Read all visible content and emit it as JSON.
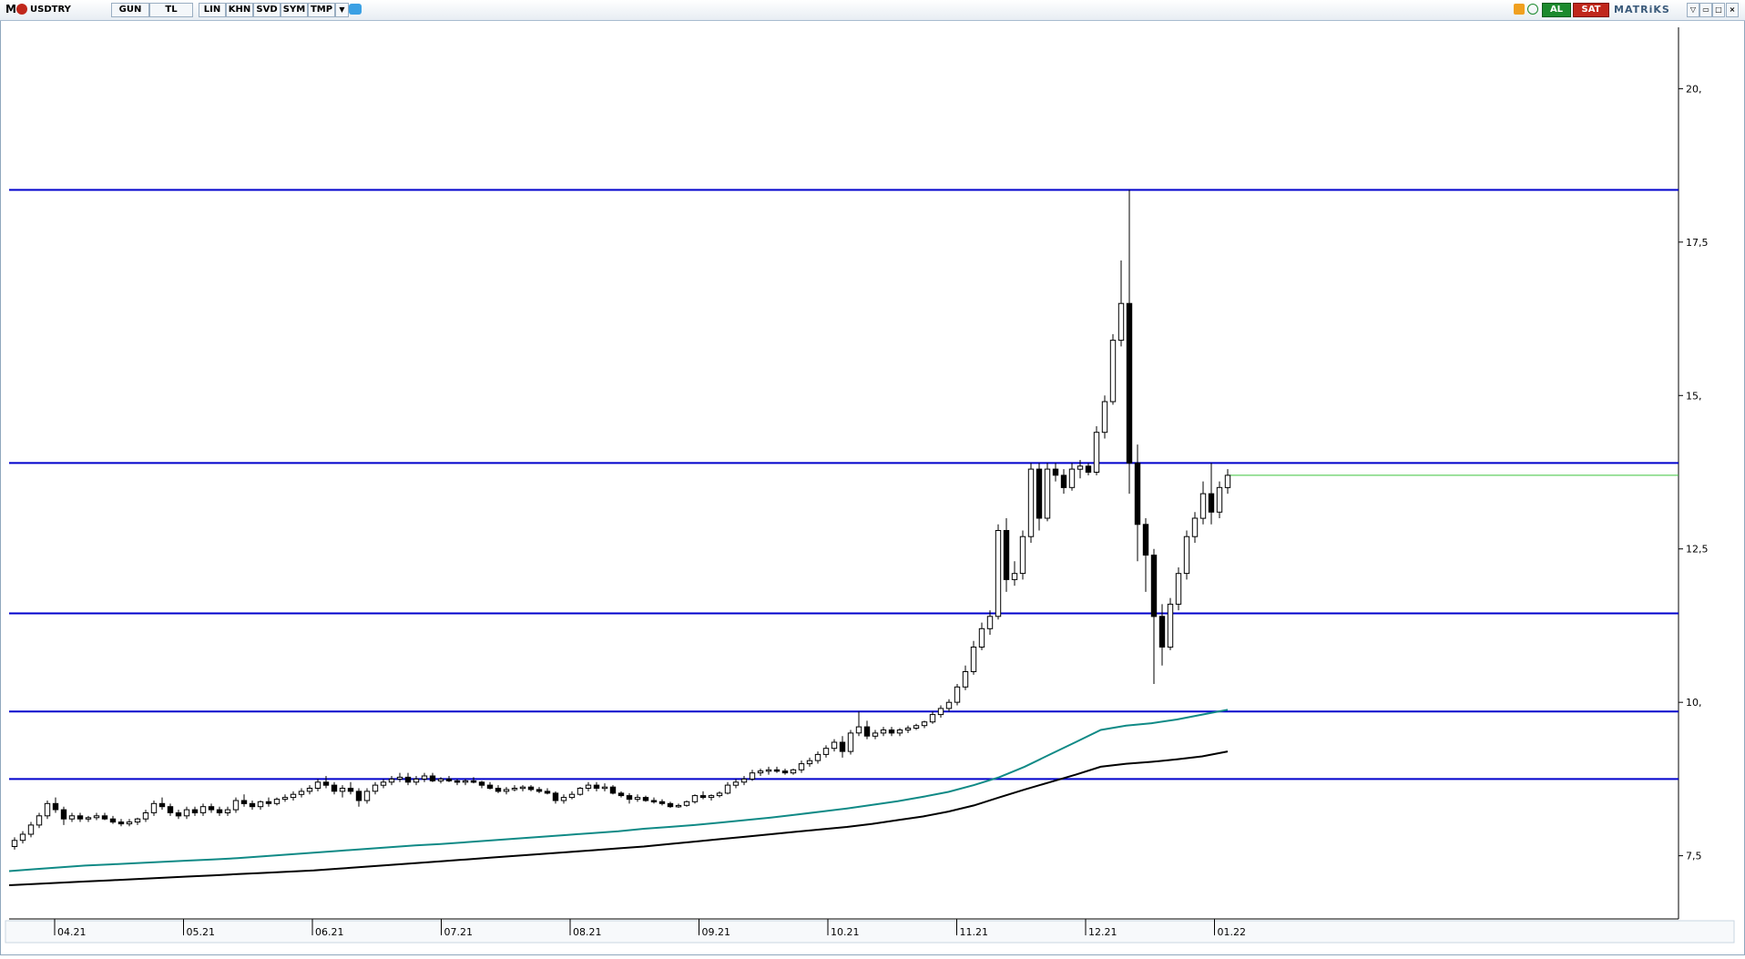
{
  "toolbar": {
    "logo": "M",
    "symbol": "USDTRY",
    "buttons": [
      "GUN",
      "TL",
      "LIN",
      "KHN",
      "SVD",
      "SYM",
      "TMP"
    ],
    "al_label": "AL",
    "sat_label": "SAT",
    "brand": "MATRiKS",
    "colors": {
      "al": "#1c8a2e",
      "sat": "#c0271b",
      "bar": "#e7edf3"
    }
  },
  "chart_data": {
    "type": "candlestick",
    "title": "USDTRY",
    "ylim": [
      6.5,
      21.0
    ],
    "y_ticks": [
      {
        "v": 20.0,
        "label": "20,"
      },
      {
        "v": 17.5,
        "label": "17,5"
      },
      {
        "v": 15.0,
        "label": "15,"
      },
      {
        "v": 12.5,
        "label": "12,5"
      },
      {
        "v": 10.0,
        "label": "10,"
      },
      {
        "v": 7.5,
        "label": "7,5"
      }
    ],
    "x_ticks": [
      "04.21",
      "05.21",
      "06.21",
      "07.21",
      "08.21",
      "09.21",
      "10.21",
      "11.21",
      "12.21",
      "01.22"
    ],
    "grid": false,
    "horizontal_lines": [
      {
        "value": 18.35,
        "color": "#0000cc"
      },
      {
        "value": 13.9,
        "color": "#0000cc"
      },
      {
        "value": 11.45,
        "color": "#0000cc"
      },
      {
        "value": 9.85,
        "color": "#0000cc"
      },
      {
        "value": 8.75,
        "color": "#0000cc"
      }
    ],
    "last_price_line": {
      "value": 13.7,
      "color": "#3cc43c"
    },
    "candles": [
      [
        7.65,
        7.8,
        7.6,
        7.75
      ],
      [
        7.75,
        7.9,
        7.7,
        7.85
      ],
      [
        7.85,
        8.05,
        7.8,
        8.0
      ],
      [
        8.0,
        8.2,
        7.95,
        8.15
      ],
      [
        8.15,
        8.4,
        8.1,
        8.35
      ],
      [
        8.35,
        8.45,
        8.2,
        8.25
      ],
      [
        8.25,
        8.3,
        8.0,
        8.1
      ],
      [
        8.1,
        8.2,
        8.05,
        8.15
      ],
      [
        8.15,
        8.2,
        8.05,
        8.1
      ],
      [
        8.1,
        8.15,
        8.05,
        8.12
      ],
      [
        8.12,
        8.2,
        8.08,
        8.15
      ],
      [
        8.15,
        8.2,
        8.08,
        8.1
      ],
      [
        8.1,
        8.15,
        8.02,
        8.05
      ],
      [
        8.05,
        8.1,
        7.98,
        8.02
      ],
      [
        8.02,
        8.1,
        7.98,
        8.05
      ],
      [
        8.05,
        8.12,
        8.0,
        8.1
      ],
      [
        8.1,
        8.25,
        8.05,
        8.2
      ],
      [
        8.2,
        8.4,
        8.15,
        8.35
      ],
      [
        8.35,
        8.45,
        8.25,
        8.3
      ],
      [
        8.3,
        8.35,
        8.15,
        8.2
      ],
      [
        8.2,
        8.25,
        8.1,
        8.15
      ],
      [
        8.15,
        8.3,
        8.1,
        8.25
      ],
      [
        8.25,
        8.3,
        8.15,
        8.2
      ],
      [
        8.2,
        8.35,
        8.15,
        8.3
      ],
      [
        8.3,
        8.35,
        8.2,
        8.25
      ],
      [
        8.25,
        8.3,
        8.15,
        8.2
      ],
      [
        8.2,
        8.3,
        8.15,
        8.25
      ],
      [
        8.25,
        8.45,
        8.2,
        8.4
      ],
      [
        8.4,
        8.5,
        8.3,
        8.35
      ],
      [
        8.35,
        8.4,
        8.25,
        8.3
      ],
      [
        8.3,
        8.4,
        8.25,
        8.38
      ],
      [
        8.38,
        8.45,
        8.3,
        8.35
      ],
      [
        8.35,
        8.45,
        8.32,
        8.42
      ],
      [
        8.42,
        8.5,
        8.38,
        8.45
      ],
      [
        8.45,
        8.55,
        8.4,
        8.5
      ],
      [
        8.5,
        8.6,
        8.45,
        8.55
      ],
      [
        8.55,
        8.65,
        8.5,
        8.6
      ],
      [
        8.6,
        8.75,
        8.55,
        8.7
      ],
      [
        8.7,
        8.8,
        8.6,
        8.65
      ],
      [
        8.65,
        8.7,
        8.5,
        8.55
      ],
      [
        8.55,
        8.65,
        8.45,
        8.6
      ],
      [
        8.6,
        8.7,
        8.5,
        8.55
      ],
      [
        8.55,
        8.6,
        8.3,
        8.4
      ],
      [
        8.4,
        8.6,
        8.35,
        8.55
      ],
      [
        8.55,
        8.7,
        8.5,
        8.65
      ],
      [
        8.65,
        8.75,
        8.6,
        8.7
      ],
      [
        8.7,
        8.8,
        8.65,
        8.75
      ],
      [
        8.75,
        8.85,
        8.7,
        8.78
      ],
      [
        8.78,
        8.85,
        8.65,
        8.7
      ],
      [
        8.7,
        8.8,
        8.65,
        8.75
      ],
      [
        8.75,
        8.85,
        8.7,
        8.8
      ],
      [
        8.8,
        8.85,
        8.7,
        8.72
      ],
      [
        8.72,
        8.78,
        8.68,
        8.75
      ],
      [
        8.75,
        8.8,
        8.7,
        8.72
      ],
      [
        8.72,
        8.75,
        8.65,
        8.7
      ],
      [
        8.7,
        8.75,
        8.65,
        8.72
      ],
      [
        8.72,
        8.78,
        8.68,
        8.7
      ],
      [
        8.7,
        8.72,
        8.6,
        8.65
      ],
      [
        8.65,
        8.7,
        8.58,
        8.6
      ],
      [
        8.6,
        8.65,
        8.52,
        8.55
      ],
      [
        8.55,
        8.62,
        8.5,
        8.58
      ],
      [
        8.58,
        8.65,
        8.55,
        8.6
      ],
      [
        8.6,
        8.65,
        8.55,
        8.62
      ],
      [
        8.62,
        8.65,
        8.55,
        8.58
      ],
      [
        8.58,
        8.62,
        8.52,
        8.55
      ],
      [
        8.55,
        8.6,
        8.5,
        8.52
      ],
      [
        8.52,
        8.55,
        8.35,
        8.4
      ],
      [
        8.4,
        8.5,
        8.35,
        8.45
      ],
      [
        8.45,
        8.55,
        8.42,
        8.5
      ],
      [
        8.5,
        8.62,
        8.48,
        8.6
      ],
      [
        8.6,
        8.7,
        8.55,
        8.65
      ],
      [
        8.65,
        8.7,
        8.55,
        8.6
      ],
      [
        8.6,
        8.68,
        8.55,
        8.62
      ],
      [
        8.62,
        8.65,
        8.5,
        8.52
      ],
      [
        8.52,
        8.55,
        8.45,
        8.48
      ],
      [
        8.48,
        8.52,
        8.35,
        8.42
      ],
      [
        8.42,
        8.5,
        8.38,
        8.45
      ],
      [
        8.45,
        8.48,
        8.38,
        8.4
      ],
      [
        8.4,
        8.45,
        8.35,
        8.38
      ],
      [
        8.38,
        8.42,
        8.32,
        8.35
      ],
      [
        8.35,
        8.38,
        8.28,
        8.3
      ],
      [
        8.3,
        8.35,
        8.28,
        8.32
      ],
      [
        8.32,
        8.4,
        8.3,
        8.38
      ],
      [
        8.38,
        8.5,
        8.35,
        8.48
      ],
      [
        8.48,
        8.55,
        8.42,
        8.45
      ],
      [
        8.45,
        8.5,
        8.4,
        8.48
      ],
      [
        8.48,
        8.55,
        8.45,
        8.52
      ],
      [
        8.52,
        8.7,
        8.5,
        8.65
      ],
      [
        8.65,
        8.75,
        8.6,
        8.7
      ],
      [
        8.7,
        8.8,
        8.65,
        8.75
      ],
      [
        8.75,
        8.9,
        8.72,
        8.85
      ],
      [
        8.85,
        8.92,
        8.8,
        8.88
      ],
      [
        8.88,
        8.95,
        8.82,
        8.9
      ],
      [
        8.9,
        8.95,
        8.85,
        8.88
      ],
      [
        8.88,
        8.92,
        8.82,
        8.85
      ],
      [
        8.85,
        8.92,
        8.82,
        8.9
      ],
      [
        8.9,
        9.05,
        8.85,
        9.0
      ],
      [
        9.0,
        9.1,
        8.95,
        9.05
      ],
      [
        9.05,
        9.2,
        9.0,
        9.15
      ],
      [
        9.15,
        9.3,
        9.1,
        9.25
      ],
      [
        9.25,
        9.4,
        9.2,
        9.35
      ],
      [
        9.35,
        9.45,
        9.1,
        9.2
      ],
      [
        9.2,
        9.55,
        9.15,
        9.5
      ],
      [
        9.5,
        9.85,
        9.45,
        9.6
      ],
      [
        9.6,
        9.7,
        9.4,
        9.45
      ],
      [
        9.45,
        9.55,
        9.4,
        9.5
      ],
      [
        9.5,
        9.6,
        9.45,
        9.55
      ],
      [
        9.55,
        9.6,
        9.45,
        9.5
      ],
      [
        9.5,
        9.58,
        9.45,
        9.55
      ],
      [
        9.55,
        9.62,
        9.5,
        9.58
      ],
      [
        9.58,
        9.65,
        9.55,
        9.62
      ],
      [
        9.62,
        9.7,
        9.58,
        9.68
      ],
      [
        9.68,
        9.85,
        9.65,
        9.8
      ],
      [
        9.8,
        9.95,
        9.75,
        9.9
      ],
      [
        9.9,
        10.05,
        9.85,
        10.0
      ],
      [
        10.0,
        10.3,
        9.95,
        10.25
      ],
      [
        10.25,
        10.6,
        10.2,
        10.5
      ],
      [
        10.5,
        11.0,
        10.45,
        10.9
      ],
      [
        10.9,
        11.3,
        10.85,
        11.2
      ],
      [
        11.2,
        11.5,
        11.1,
        11.4
      ],
      [
        11.4,
        12.9,
        11.35,
        12.8
      ],
      [
        12.8,
        13.0,
        11.8,
        12.0
      ],
      [
        12.0,
        12.3,
        11.9,
        12.1
      ],
      [
        12.1,
        12.8,
        12.0,
        12.7
      ],
      [
        12.7,
        13.9,
        12.6,
        13.8
      ],
      [
        13.8,
        13.9,
        12.8,
        13.0
      ],
      [
        13.0,
        13.9,
        12.95,
        13.8
      ],
      [
        13.8,
        13.9,
        13.6,
        13.7
      ],
      [
        13.7,
        13.8,
        13.4,
        13.5
      ],
      [
        13.5,
        13.9,
        13.45,
        13.8
      ],
      [
        13.8,
        13.95,
        13.65,
        13.85
      ],
      [
        13.85,
        13.9,
        13.7,
        13.75
      ],
      [
        13.75,
        14.5,
        13.7,
        14.4
      ],
      [
        14.4,
        15.0,
        14.3,
        14.9
      ],
      [
        14.9,
        16.0,
        14.85,
        15.9
      ],
      [
        15.9,
        17.2,
        15.8,
        16.5
      ],
      [
        16.5,
        18.35,
        13.4,
        13.9
      ],
      [
        13.9,
        14.2,
        12.3,
        12.9
      ],
      [
        12.9,
        13.0,
        11.8,
        12.4
      ],
      [
        12.4,
        12.5,
        10.3,
        11.4
      ],
      [
        11.4,
        11.6,
        10.6,
        10.9
      ],
      [
        10.9,
        11.7,
        10.85,
        11.6
      ],
      [
        11.6,
        12.2,
        11.5,
        12.1
      ],
      [
        12.1,
        12.8,
        12.0,
        12.7
      ],
      [
        12.7,
        13.1,
        12.6,
        13.0
      ],
      [
        13.0,
        13.6,
        12.9,
        13.4
      ],
      [
        13.4,
        13.9,
        12.9,
        13.1
      ],
      [
        13.1,
        13.6,
        13.0,
        13.5
      ],
      [
        13.5,
        13.8,
        13.4,
        13.7
      ]
    ],
    "series": [
      {
        "name": "",
        "color": "#108a86",
        "values": [
          7.25,
          7.28,
          7.31,
          7.34,
          7.36,
          7.38,
          7.4,
          7.42,
          7.44,
          7.46,
          7.49,
          7.52,
          7.55,
          7.58,
          7.61,
          7.64,
          7.67,
          7.69,
          7.72,
          7.75,
          7.78,
          7.81,
          7.84,
          7.87,
          7.9,
          7.94,
          7.97,
          8.0,
          8.04,
          8.08,
          8.12,
          8.17,
          8.22,
          8.27,
          8.33,
          8.39,
          8.46,
          8.54,
          8.65,
          8.78,
          8.95,
          9.15,
          9.35,
          9.55,
          9.62,
          9.66,
          9.72,
          9.8,
          9.88
        ]
      },
      {
        "name": "",
        "color": "#000000",
        "values": [
          7.02,
          7.04,
          7.06,
          7.08,
          7.1,
          7.12,
          7.14,
          7.16,
          7.18,
          7.2,
          7.22,
          7.24,
          7.26,
          7.29,
          7.32,
          7.35,
          7.38,
          7.41,
          7.44,
          7.47,
          7.5,
          7.53,
          7.56,
          7.59,
          7.62,
          7.65,
          7.69,
          7.73,
          7.77,
          7.81,
          7.85,
          7.89,
          7.93,
          7.97,
          8.02,
          8.08,
          8.14,
          8.22,
          8.32,
          8.45,
          8.58,
          8.7,
          8.82,
          8.95,
          9.0,
          9.03,
          9.07,
          9.12,
          9.2
        ]
      }
    ]
  }
}
